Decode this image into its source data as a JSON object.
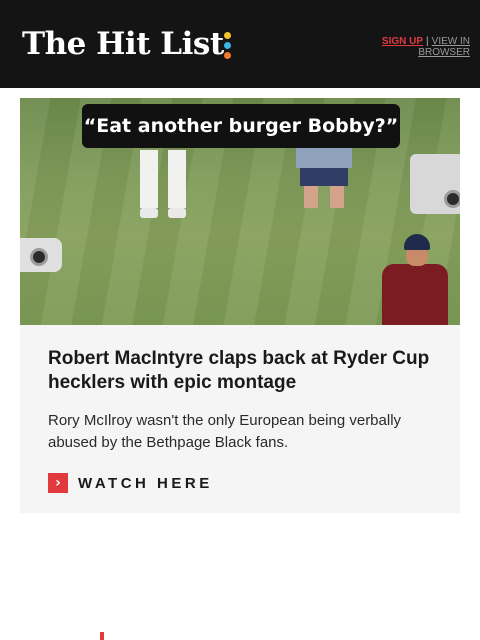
{
  "header": {
    "logo_text": "The Hit List",
    "sign_up": "SIGN UP",
    "separator": "|",
    "view_in_browser": "VIEW IN BROWSER",
    "background": "#141414",
    "dot_colors": [
      "#f3c42c",
      "#3bb6e6",
      "#ef7a2a"
    ]
  },
  "article": {
    "image_caption": "“Eat another burger Bobby?”",
    "headline": "Robert MacIntyre claps back at Ryder Cup hecklers with epic montage",
    "summary": "Rory McIlroy wasn't the only European being verbally abused by the Bethpage Black fans.",
    "cta_label": "WATCH HERE",
    "cta_icon": "chevron-right-icon"
  },
  "colors": {
    "accent": "#e03a3e",
    "card_background": "#f5f5f5"
  }
}
